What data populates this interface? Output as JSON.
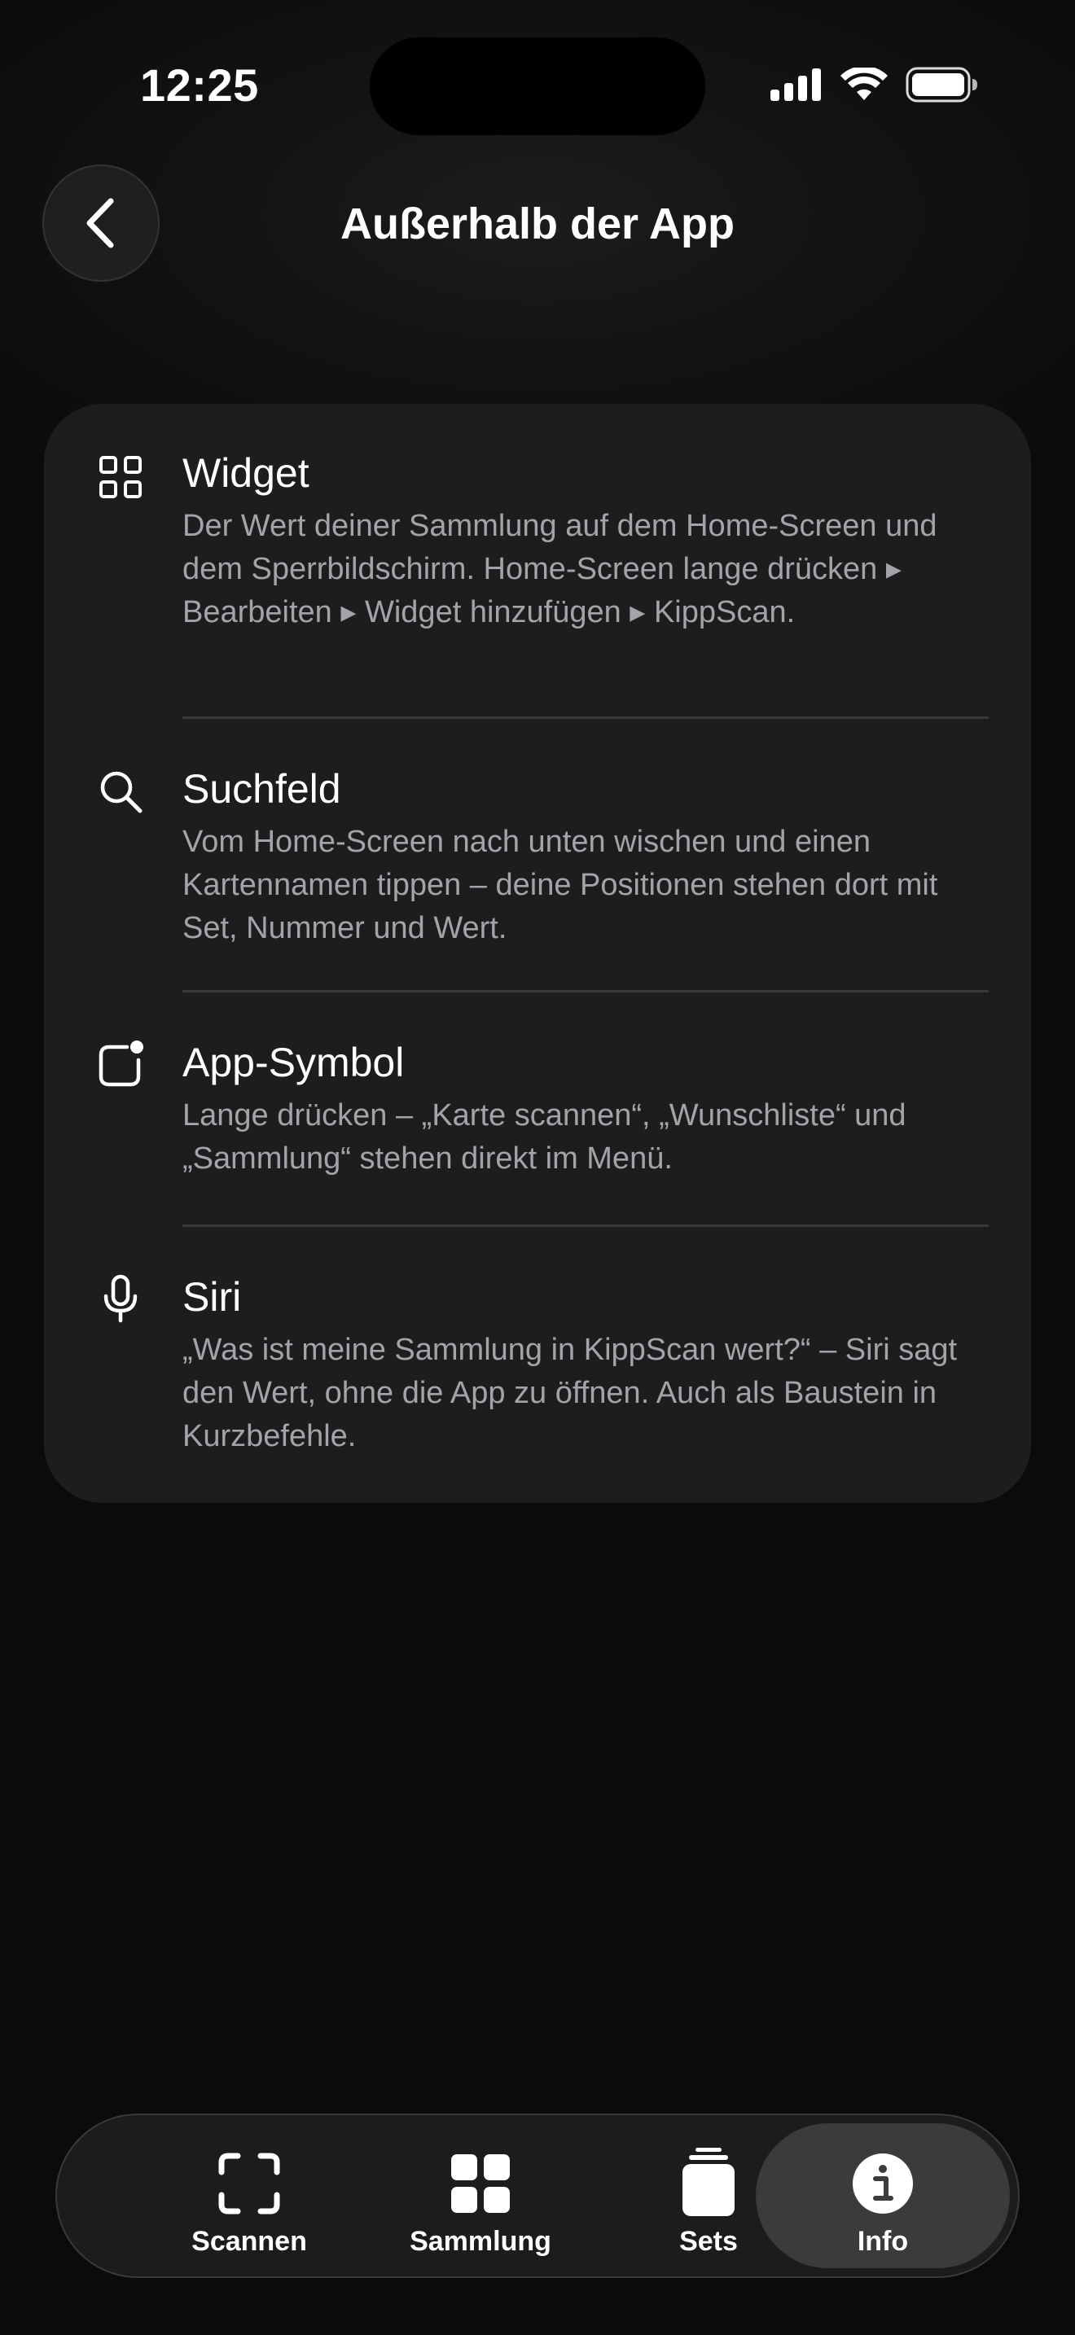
{
  "status_bar": {
    "time": "12:25"
  },
  "header": {
    "title": "Außerhalb der App"
  },
  "items": [
    {
      "icon": "grid-icon",
      "title": "Widget",
      "description": "Der Wert deiner Sammlung auf dem Home-Screen und dem Sperrbildschirm. Home-Screen lange drücken ▸ Bearbeiten ▸ Widget hinzufügen ▸ KippScan."
    },
    {
      "icon": "search-icon",
      "title": "Suchfeld",
      "description": "Vom Home-Screen nach unten wischen und einen Kartennamen tippen – deine Positionen stehen dort mit Set, Nummer und Wert."
    },
    {
      "icon": "app-badge-icon",
      "title": "App-Symbol",
      "description": "Lange drücken – „Karte scannen“, „Wunschliste“ und „Sammlung“ stehen direkt im Menü."
    },
    {
      "icon": "microphone-icon",
      "title": "Siri",
      "description": "„Was ist meine Sammlung in KippScan wert?“ – Siri sagt den Wert, ohne die App zu öffnen. Auch als Baustein in Kurzbefehle."
    }
  ],
  "tab_bar": {
    "tabs": [
      {
        "label": "Scannen",
        "icon": "scan-icon"
      },
      {
        "label": "Sammlung",
        "icon": "collection-grid-icon"
      },
      {
        "label": "Sets",
        "icon": "stack-icon"
      },
      {
        "label": "Info",
        "icon": "info-icon"
      }
    ],
    "active_tab": "Info"
  },
  "colors": {
    "background": "#0b0b0c",
    "card": "#1d1d1f",
    "secondary_text": "#a4a4a8",
    "active_tab": "#3b3b3d"
  }
}
